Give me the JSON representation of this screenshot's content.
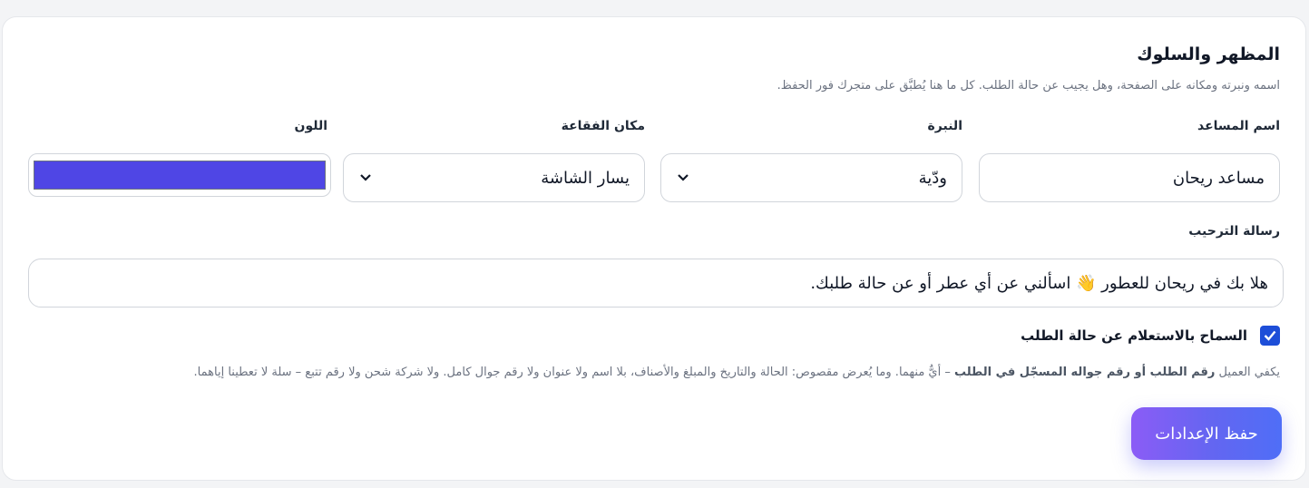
{
  "section": {
    "title": "المظهر والسلوك",
    "subtitle": "اسمه ونبرته ومكانه على الصفحة، وهل يجيب عن حالة الطلب. كل ما هنا يُطبَّق على متجرك فور الحفظ."
  },
  "fields": {
    "assistant_name": {
      "label": "اسم المساعد",
      "value": "مساعد ريحان"
    },
    "tone": {
      "label": "النبرة",
      "value": "ودّية"
    },
    "bubble_position": {
      "label": "مكان الفقاعة",
      "value": "يسار الشاشة"
    },
    "color": {
      "label": "اللون",
      "value": "#4f46e5"
    }
  },
  "welcome": {
    "label": "رسالة الترحيب",
    "value": "هلا بك في ريحان للعطور 👋 اسألني عن أي عطر أو عن حالة طلبك."
  },
  "order_lookup": {
    "label": "السماح بالاستعلام عن حالة الطلب",
    "checked": true,
    "hint_prefix": "يكفي العميل ",
    "hint_bold": "رقم الطلب أو رقم جواله المسجّل في الطلب",
    "hint_suffix": " – أيٌّ منهما. وما يُعرض مقصوص: الحالة والتاريخ والمبلغ والأصناف، بلا اسم ولا عنوان ولا رقم جوال كامل. ولا شركة شحن ولا رقم تتبع – سلة لا تعطينا إياهما."
  },
  "actions": {
    "save_label": "حفظ الإعدادات"
  },
  "icons": {
    "select_chevron": "chevron-down-icon",
    "checkbox_check": "check-icon"
  },
  "colors": {
    "accent": "#4f46e5",
    "checkbox": "#1d4ed8",
    "button_gradient_start": "#8b5cf6",
    "button_gradient_end": "#4f6ef7"
  }
}
